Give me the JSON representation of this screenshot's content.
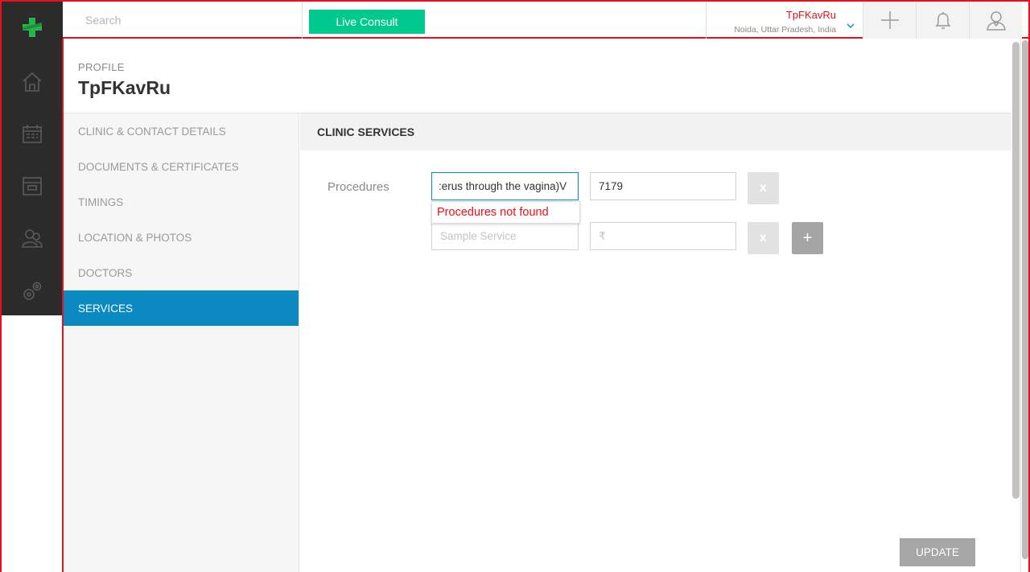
{
  "topbar": {
    "search_placeholder": "Search",
    "live_consult_label": "Live Consult",
    "clinic_name": "TpFKavRu",
    "clinic_location": "Noida, Uttar Pradesh, India",
    "icons": [
      "plus-icon",
      "bell-icon",
      "user-icon"
    ]
  },
  "leftnav": {
    "logo": "practo-cross-logo",
    "items": [
      "home-icon",
      "calendar-icon",
      "archive-icon",
      "patients-icon",
      "settings-icon"
    ]
  },
  "profile": {
    "kicker": "PROFILE",
    "title": "TpFKavRu"
  },
  "side_menu": {
    "items": [
      {
        "label": "CLINIC & CONTACT DETAILS",
        "active": false
      },
      {
        "label": "DOCUMENTS & CERTIFICATES",
        "active": false
      },
      {
        "label": "TIMINGS",
        "active": false
      },
      {
        "label": "LOCATION & PHOTOS",
        "active": false
      },
      {
        "label": "DOCTORS",
        "active": false
      },
      {
        "label": "SERVICES",
        "active": true
      }
    ]
  },
  "services": {
    "section_title": "CLINIC SERVICES",
    "procedures_label": "Procedures",
    "rows": [
      {
        "service_value": ":erus through the vagina)V",
        "price_value": "7179",
        "remove_label": "x"
      },
      {
        "service_placeholder": "Sample Service",
        "price_placeholder": "₹",
        "remove_label": "x",
        "add_label": "+"
      }
    ],
    "not_found_message": "Procedures not found",
    "update_label": "UPDATE"
  },
  "colors": {
    "accent_blue": "#0a8ac0",
    "brand_green": "#00c98d",
    "error_red": "#e8101c",
    "nav_dark": "#2b2b2b"
  }
}
